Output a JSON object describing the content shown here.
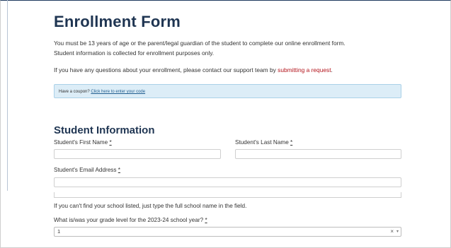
{
  "form": {
    "title": "Enrollment Form",
    "intro_line1": "You must be 13 years of age or the parent/legal guardian of the student to complete our online enrollment form.",
    "intro_line2": "Student information is collected for enrollment purposes only.",
    "contact_prefix": "If you have any questions about your enrollment, please contact our support team by ",
    "contact_link": "submitting a request",
    "contact_suffix": ".",
    "coupon_prefix": "Have a coupon? ",
    "coupon_link": "Click here to enter your code"
  },
  "student": {
    "section_title": "Student Information",
    "first_name_label": "Student's First Name",
    "last_name_label": "Student's Last Name",
    "email_label": "Student's Email Address",
    "required_mark": "*",
    "school_help": "If you can't find your school listed, just type the full school name in the field.",
    "grade_label": "What is/was your grade level for the 2023-24 school year?",
    "grade_value": "1",
    "clear_symbol": "×",
    "chevron_symbol": "▾"
  },
  "colors": {
    "heading": "#1f3552",
    "link_red": "#b3141c",
    "coupon_bg": "#dcedf7"
  }
}
